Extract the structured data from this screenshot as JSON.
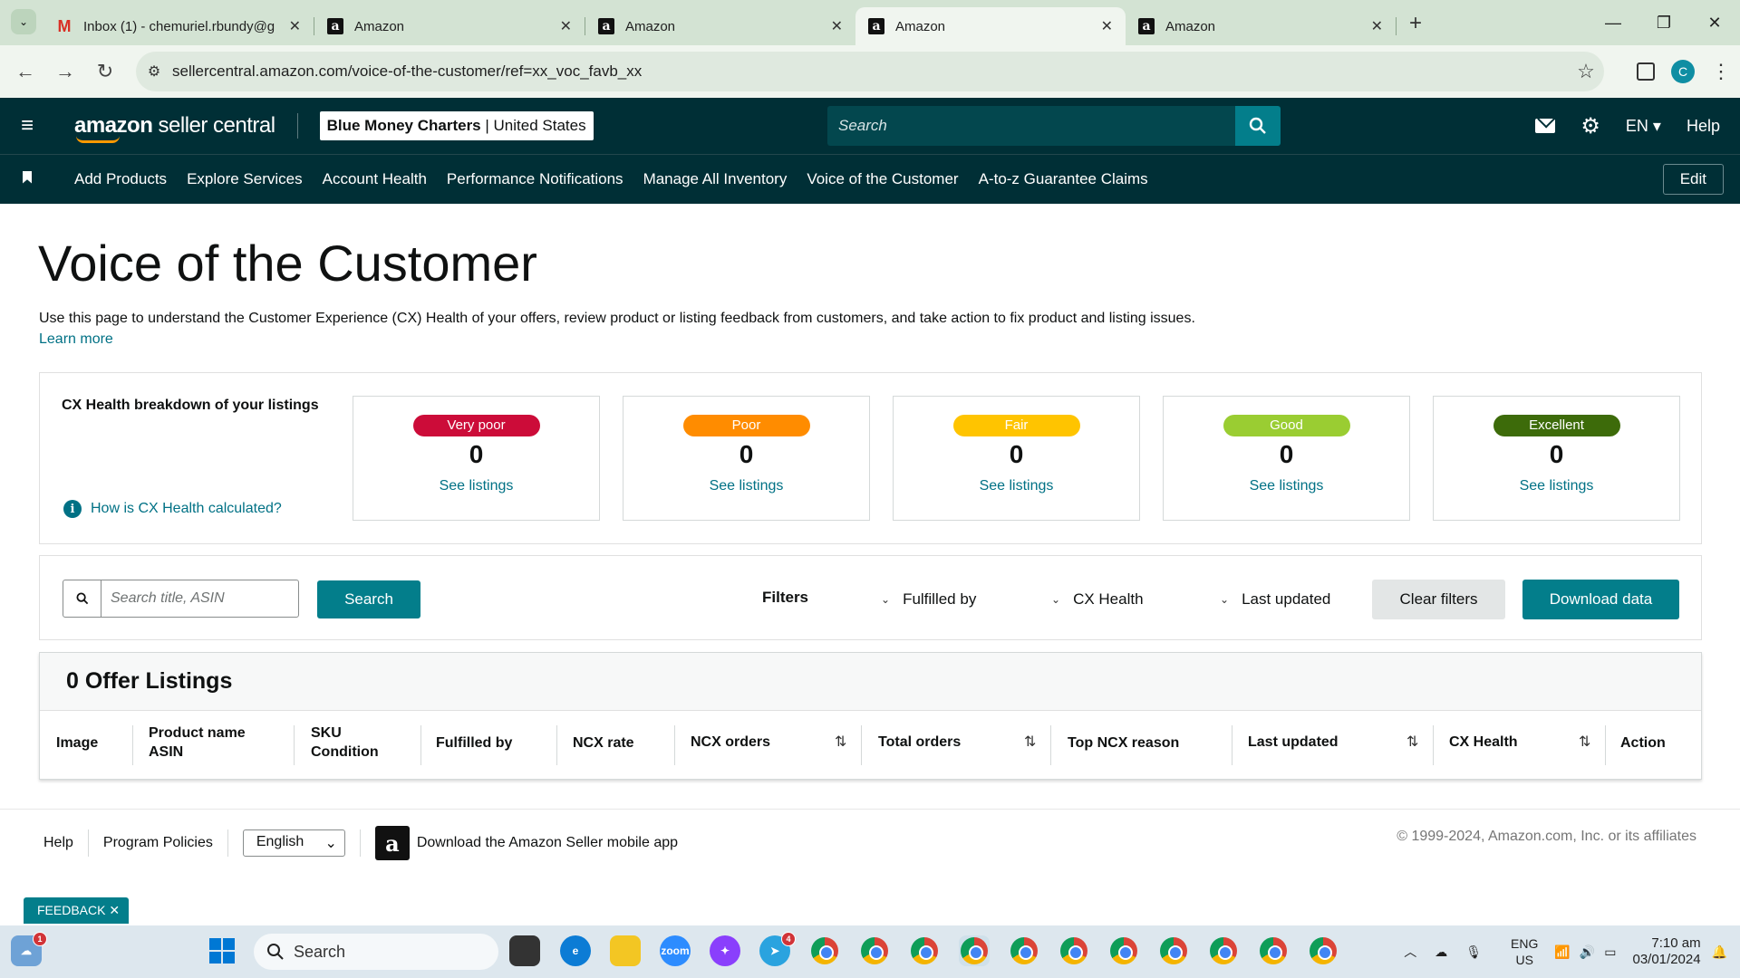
{
  "browser": {
    "tabs": [
      {
        "title": "Inbox (1) - chemuriel.rbundy@g",
        "icon": "gmail-icon",
        "active": false
      },
      {
        "title": "Amazon",
        "icon": "amazon-icon",
        "active": false
      },
      {
        "title": "Amazon",
        "icon": "amazon-icon",
        "active": false
      },
      {
        "title": "Amazon",
        "icon": "amazon-icon",
        "active": true
      },
      {
        "title": "Amazon",
        "icon": "amazon-icon",
        "active": false
      }
    ],
    "url": "sellercentral.amazon.com/voice-of-the-customer/ref=xx_voc_favb_xx",
    "profile_initial": "C"
  },
  "header": {
    "logo_text_bold": "amazon",
    "logo_text_rest": " seller central",
    "store_name": "Blue Money Charters",
    "store_region": "United States",
    "search_placeholder": "Search",
    "language": "EN",
    "help": "Help"
  },
  "nav": {
    "links": [
      "Add Products",
      "Explore Services",
      "Account Health",
      "Performance Notifications",
      "Manage All Inventory",
      "Voice of the Customer",
      "A-to-z Guarantee Claims"
    ],
    "edit": "Edit"
  },
  "page": {
    "title": "Voice of the Customer",
    "intro": "Use this page to understand the Customer Experience (CX) Health of your offers, review product or listing feedback from customers, and take action to fix product and listing issues.",
    "learn_more": "Learn more"
  },
  "cx": {
    "title": "CX Health breakdown of your listings",
    "help_link": "How is CX Health calculated?",
    "cards": [
      {
        "label": "Very poor",
        "count": "0",
        "link": "See listings",
        "color": "#cc0c39"
      },
      {
        "label": "Poor",
        "count": "0",
        "link": "See listings",
        "color": "#ff8c00"
      },
      {
        "label": "Fair",
        "count": "0",
        "link": "See listings",
        "color": "#ffc400"
      },
      {
        "label": "Good",
        "count": "0",
        "link": "See listings",
        "color": "#9acd32"
      },
      {
        "label": "Excellent",
        "count": "0",
        "link": "See listings",
        "color": "#3d6b0a"
      }
    ]
  },
  "filters": {
    "search_placeholder": "Search title, ASIN",
    "search_button": "Search",
    "label": "Filters",
    "dropdowns": [
      "Fulfilled by",
      "CX Health",
      "Last updated"
    ],
    "clear": "Clear filters",
    "download": "Download data"
  },
  "table": {
    "heading": "0 Offer Listings",
    "columns": {
      "image": "Image",
      "product_line1": "Product name",
      "product_line2": "ASIN",
      "sku_line1": "SKU",
      "sku_line2": "Condition",
      "fulfilled": "Fulfilled by",
      "ncx_rate": "NCX rate",
      "ncx_orders": "NCX orders",
      "total_orders": "Total orders",
      "top_reason": "Top NCX reason",
      "last_updated": "Last updated",
      "cx_health": "CX Health",
      "action": "Action"
    }
  },
  "footer": {
    "help": "Help",
    "policies": "Program Policies",
    "language": "English",
    "app_link": "Download the Amazon Seller mobile app",
    "copyright": "© 1999-2024, Amazon.com, Inc. or its affiliates",
    "feedback": "FEEDBACK"
  },
  "taskbar": {
    "search": "Search",
    "lang_line1": "ENG",
    "lang_line2": "US",
    "time": "7:10 am",
    "date": "03/01/2024",
    "weather_badge": "1",
    "telegram_badge": "4"
  }
}
